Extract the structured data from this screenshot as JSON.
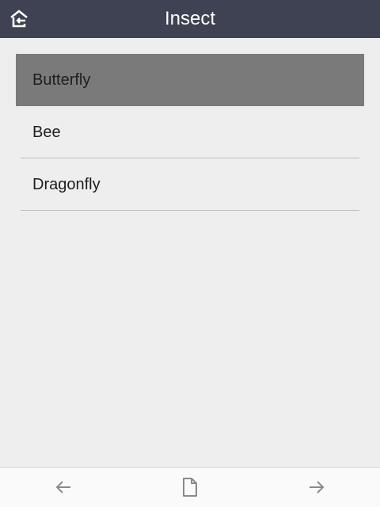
{
  "header": {
    "title": "Insect",
    "home_icon": "home-back-icon"
  },
  "list": {
    "items": [
      {
        "label": "Butterfly",
        "selected": true
      },
      {
        "label": "Bee",
        "selected": false
      },
      {
        "label": "Dragonfly",
        "selected": false
      }
    ]
  },
  "footer": {
    "back_icon": "arrow-left-icon",
    "page_icon": "document-icon",
    "forward_icon": "arrow-right-icon"
  },
  "colors": {
    "header_bg": "#3e4252",
    "selected_bg": "#7a7a7a",
    "page_bg": "#eeeeee"
  }
}
